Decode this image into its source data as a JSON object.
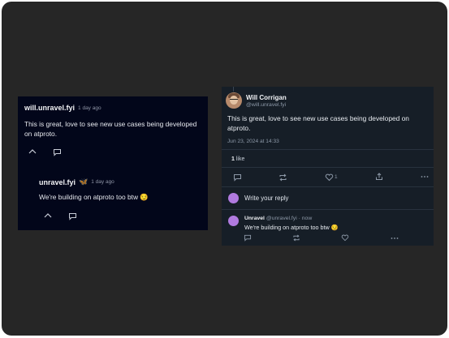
{
  "left_card": {
    "comment": {
      "handle": "will.unravel.fyi",
      "time": "1 day ago",
      "text": "This is great, love to see new use cases being developed on atproto."
    },
    "reply": {
      "handle": "unravel.fyi",
      "badge": "🦋",
      "time": "1 day ago",
      "text": "We're building on atproto too btw 😏"
    },
    "icons": [
      "chevron-up-icon",
      "comment-icon"
    ]
  },
  "right_card": {
    "post": {
      "author": "Will Corrigan",
      "handle": "@will.unravel.fyi",
      "text": "This is great, love to see new use cases being developed on atproto.",
      "date": "Jun 23, 2024 at 14:33"
    },
    "likes": {
      "count": "1",
      "label": "like"
    },
    "actions": {
      "like_count": "1"
    },
    "reply_prompt": "Write your reply",
    "reply": {
      "author": "Unravel",
      "handle": "@unravel.fyi",
      "time": "· now",
      "text": "We're building on atproto too btw 😏"
    },
    "colors": {
      "left_bg": "#02061a",
      "right_bg": "#161e27",
      "accent": "#b07adf"
    }
  }
}
